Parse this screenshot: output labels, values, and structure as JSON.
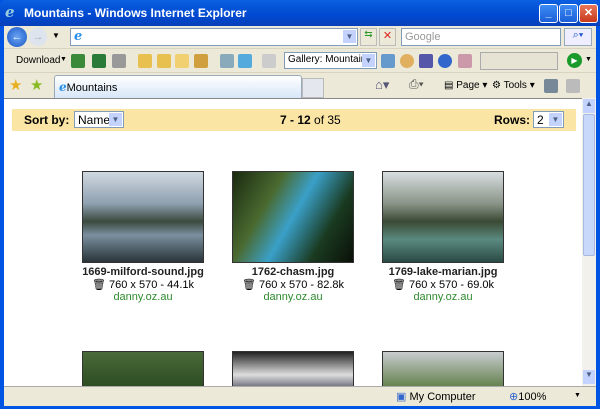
{
  "window": {
    "title": "Mountains - Windows Internet Explorer"
  },
  "nav": {
    "address": "",
    "search_placeholder": "Google"
  },
  "toolbar": {
    "download_label": "Download",
    "gallery_select": "Gallery: Mountains"
  },
  "tabs": [
    {
      "label": "Mountains"
    }
  ],
  "command_bar": {
    "page_label": "Page",
    "tools_label": "Tools"
  },
  "gallery": {
    "sort_label": "Sort by:",
    "sort_value": "Name",
    "range": "7 - 12",
    "of_label": "of 35",
    "rows_label": "Rows:",
    "rows_value": "2",
    "items": [
      {
        "name": "1669-milford-sound.jpg",
        "info": "760 x 570 - 44.1k",
        "site": "danny.oz.au"
      },
      {
        "name": "1762-chasm.jpg",
        "info": "760 x 570 - 82.8k",
        "site": "danny.oz.au"
      },
      {
        "name": "1769-lake-marian.jpg",
        "info": "760 x 570 - 69.0k",
        "site": "danny.oz.au"
      }
    ]
  },
  "status": {
    "zone": "My Computer",
    "zoom": "100%"
  }
}
